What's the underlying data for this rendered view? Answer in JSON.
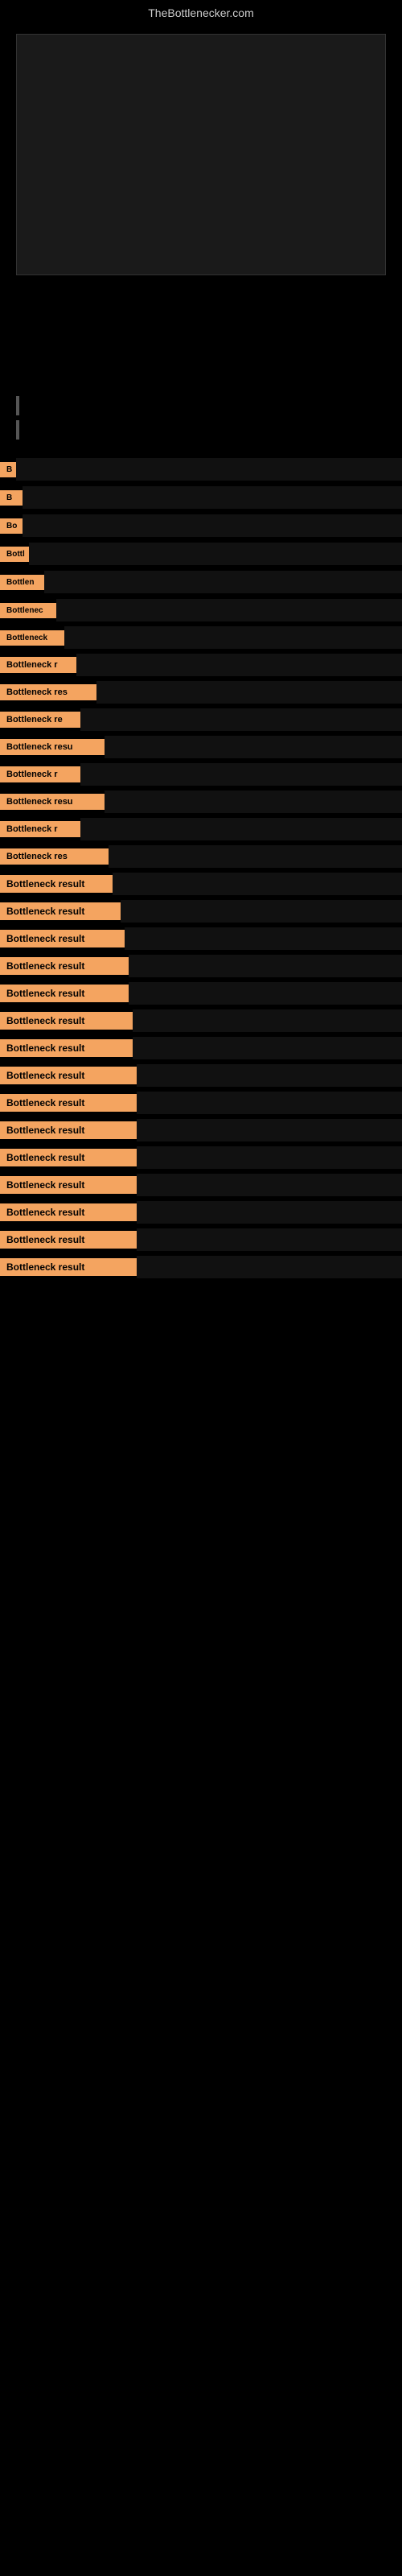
{
  "site": {
    "title": "TheBottlenecker.com"
  },
  "items": [
    {
      "id": 1,
      "label": "B",
      "class": "item-1"
    },
    {
      "id": 2,
      "label": "B",
      "class": "item-2"
    },
    {
      "id": 3,
      "label": "Bo",
      "class": "item-3"
    },
    {
      "id": 4,
      "label": "Bottl",
      "class": "item-4"
    },
    {
      "id": 5,
      "label": "Bottlen",
      "class": "item-5"
    },
    {
      "id": 6,
      "label": "Bottlenec",
      "class": "item-6"
    },
    {
      "id": 7,
      "label": "Bottleneck",
      "class": "item-7"
    },
    {
      "id": 8,
      "label": "Bottleneck r",
      "class": "item-8"
    },
    {
      "id": 9,
      "label": "Bottleneck res",
      "class": "item-9"
    },
    {
      "id": 10,
      "label": "Bottleneck re",
      "class": "item-10"
    },
    {
      "id": 11,
      "label": "Bottleneck resu",
      "class": "item-11"
    },
    {
      "id": 12,
      "label": "Bottleneck r",
      "class": "item-12"
    },
    {
      "id": 13,
      "label": "Bottleneck resu",
      "class": "item-13"
    },
    {
      "id": 14,
      "label": "Bottleneck r",
      "class": "item-14"
    },
    {
      "id": 15,
      "label": "Bottleneck res",
      "class": "item-15"
    },
    {
      "id": 16,
      "label": "Bottleneck result",
      "class": "item-16"
    },
    {
      "id": 17,
      "label": "Bottleneck result",
      "class": "item-17"
    },
    {
      "id": 18,
      "label": "Bottleneck result",
      "class": "item-18"
    },
    {
      "id": 19,
      "label": "Bottleneck result",
      "class": "item-19"
    },
    {
      "id": 20,
      "label": "Bottleneck result",
      "class": "item-20"
    },
    {
      "id": 21,
      "label": "Bottleneck result",
      "class": "item-21"
    },
    {
      "id": 22,
      "label": "Bottleneck result",
      "class": "item-22"
    },
    {
      "id": 23,
      "label": "Bottleneck result",
      "class": "item-23"
    },
    {
      "id": 24,
      "label": "Bottleneck result",
      "class": "item-24"
    },
    {
      "id": 25,
      "label": "Bottleneck result",
      "class": "item-25"
    },
    {
      "id": 26,
      "label": "Bottleneck result",
      "class": "item-26"
    },
    {
      "id": 27,
      "label": "Bottleneck result",
      "class": "item-27"
    },
    {
      "id": 28,
      "label": "Bottleneck result",
      "class": "item-28"
    },
    {
      "id": 29,
      "label": "Bottleneck result",
      "class": "item-29"
    },
    {
      "id": 30,
      "label": "Bottleneck result",
      "class": "item-30"
    }
  ]
}
